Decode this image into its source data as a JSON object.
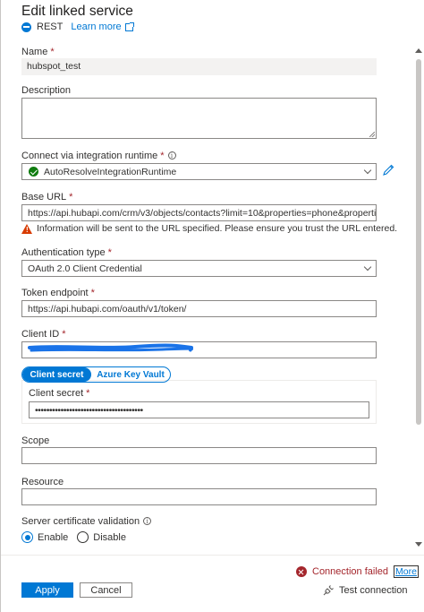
{
  "header": {
    "title": "Edit linked service",
    "service_type": "REST",
    "learn_more": "Learn more"
  },
  "name": {
    "label": "Name",
    "required": "*",
    "value": "hubspot_test"
  },
  "description": {
    "label": "Description",
    "value": ""
  },
  "runtime": {
    "label": "Connect via integration runtime",
    "required": "*",
    "value": "AutoResolveIntegrationRuntime"
  },
  "base_url": {
    "label": "Base URL",
    "required": "*",
    "value": "https://api.hubapi.com/crm/v3/objects/contacts?limit=10&properties=phone&properties=",
    "warning": "Information will be sent to the URL specified. Please ensure you trust the URL entered."
  },
  "auth_type": {
    "label": "Authentication type",
    "required": "*",
    "value": "OAuth 2.0 Client Credential"
  },
  "token_endpoint": {
    "label": "Token endpoint",
    "required": "*",
    "value": "https://api.hubapi.com/oauth/v1/token/"
  },
  "client_id": {
    "label": "Client ID",
    "required": "*",
    "value": ""
  },
  "secret_toggle": {
    "option_1": "Client secret",
    "option_2": "Azure Key Vault",
    "selected": "Client secret"
  },
  "client_secret": {
    "label": "Client secret",
    "required": "*",
    "value": "••••••••••••••••••••••••••••••••••••••"
  },
  "scope": {
    "label": "Scope",
    "value": ""
  },
  "resource": {
    "label": "Resource",
    "value": ""
  },
  "cert_validation": {
    "label": "Server certificate validation",
    "option_enable": "Enable",
    "option_disable": "Disable",
    "selected": "Enable"
  },
  "footer": {
    "connection_status": "Connection failed",
    "more": "More",
    "apply": "Apply",
    "cancel": "Cancel",
    "test_connection": "Test connection"
  },
  "colors": {
    "accent": "#0078d4",
    "error": "#a4262c",
    "success": "#107c10",
    "warning": "#d83b01",
    "redaction": "#1a73e8"
  }
}
